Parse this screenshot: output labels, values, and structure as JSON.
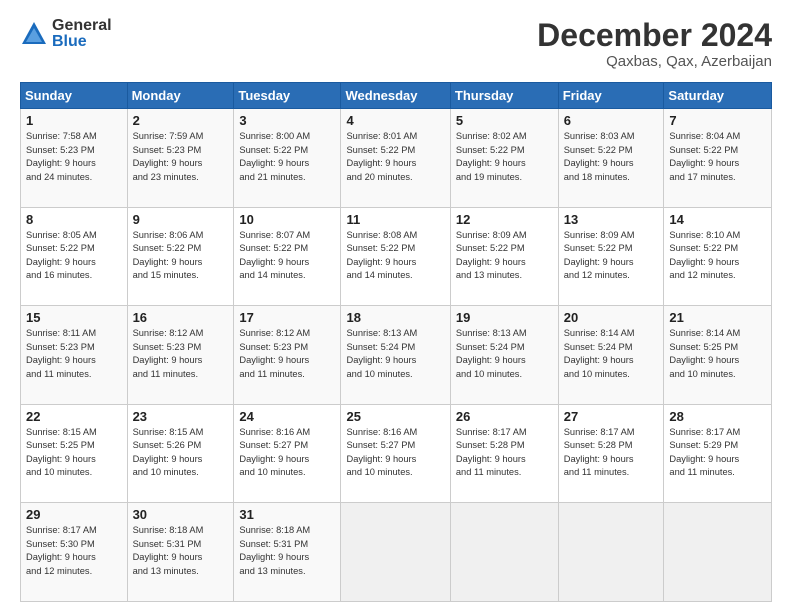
{
  "header": {
    "logo_general": "General",
    "logo_blue": "Blue",
    "month_title": "December 2024",
    "location": "Qaxbas, Qax, Azerbaijan"
  },
  "weekdays": [
    "Sunday",
    "Monday",
    "Tuesday",
    "Wednesday",
    "Thursday",
    "Friday",
    "Saturday"
  ],
  "weeks": [
    [
      {
        "day": "1",
        "lines": [
          "Sunrise: 7:58 AM",
          "Sunset: 5:23 PM",
          "Daylight: 9 hours",
          "and 24 minutes."
        ]
      },
      {
        "day": "2",
        "lines": [
          "Sunrise: 7:59 AM",
          "Sunset: 5:23 PM",
          "Daylight: 9 hours",
          "and 23 minutes."
        ]
      },
      {
        "day": "3",
        "lines": [
          "Sunrise: 8:00 AM",
          "Sunset: 5:22 PM",
          "Daylight: 9 hours",
          "and 21 minutes."
        ]
      },
      {
        "day": "4",
        "lines": [
          "Sunrise: 8:01 AM",
          "Sunset: 5:22 PM",
          "Daylight: 9 hours",
          "and 20 minutes."
        ]
      },
      {
        "day": "5",
        "lines": [
          "Sunrise: 8:02 AM",
          "Sunset: 5:22 PM",
          "Daylight: 9 hours",
          "and 19 minutes."
        ]
      },
      {
        "day": "6",
        "lines": [
          "Sunrise: 8:03 AM",
          "Sunset: 5:22 PM",
          "Daylight: 9 hours",
          "and 18 minutes."
        ]
      },
      {
        "day": "7",
        "lines": [
          "Sunrise: 8:04 AM",
          "Sunset: 5:22 PM",
          "Daylight: 9 hours",
          "and 17 minutes."
        ]
      }
    ],
    [
      {
        "day": "8",
        "lines": [
          "Sunrise: 8:05 AM",
          "Sunset: 5:22 PM",
          "Daylight: 9 hours",
          "and 16 minutes."
        ]
      },
      {
        "day": "9",
        "lines": [
          "Sunrise: 8:06 AM",
          "Sunset: 5:22 PM",
          "Daylight: 9 hours",
          "and 15 minutes."
        ]
      },
      {
        "day": "10",
        "lines": [
          "Sunrise: 8:07 AM",
          "Sunset: 5:22 PM",
          "Daylight: 9 hours",
          "and 14 minutes."
        ]
      },
      {
        "day": "11",
        "lines": [
          "Sunrise: 8:08 AM",
          "Sunset: 5:22 PM",
          "Daylight: 9 hours",
          "and 14 minutes."
        ]
      },
      {
        "day": "12",
        "lines": [
          "Sunrise: 8:09 AM",
          "Sunset: 5:22 PM",
          "Daylight: 9 hours",
          "and 13 minutes."
        ]
      },
      {
        "day": "13",
        "lines": [
          "Sunrise: 8:09 AM",
          "Sunset: 5:22 PM",
          "Daylight: 9 hours",
          "and 12 minutes."
        ]
      },
      {
        "day": "14",
        "lines": [
          "Sunrise: 8:10 AM",
          "Sunset: 5:22 PM",
          "Daylight: 9 hours",
          "and 12 minutes."
        ]
      }
    ],
    [
      {
        "day": "15",
        "lines": [
          "Sunrise: 8:11 AM",
          "Sunset: 5:23 PM",
          "Daylight: 9 hours",
          "and 11 minutes."
        ]
      },
      {
        "day": "16",
        "lines": [
          "Sunrise: 8:12 AM",
          "Sunset: 5:23 PM",
          "Daylight: 9 hours",
          "and 11 minutes."
        ]
      },
      {
        "day": "17",
        "lines": [
          "Sunrise: 8:12 AM",
          "Sunset: 5:23 PM",
          "Daylight: 9 hours",
          "and 11 minutes."
        ]
      },
      {
        "day": "18",
        "lines": [
          "Sunrise: 8:13 AM",
          "Sunset: 5:24 PM",
          "Daylight: 9 hours",
          "and 10 minutes."
        ]
      },
      {
        "day": "19",
        "lines": [
          "Sunrise: 8:13 AM",
          "Sunset: 5:24 PM",
          "Daylight: 9 hours",
          "and 10 minutes."
        ]
      },
      {
        "day": "20",
        "lines": [
          "Sunrise: 8:14 AM",
          "Sunset: 5:24 PM",
          "Daylight: 9 hours",
          "and 10 minutes."
        ]
      },
      {
        "day": "21",
        "lines": [
          "Sunrise: 8:14 AM",
          "Sunset: 5:25 PM",
          "Daylight: 9 hours",
          "and 10 minutes."
        ]
      }
    ],
    [
      {
        "day": "22",
        "lines": [
          "Sunrise: 8:15 AM",
          "Sunset: 5:25 PM",
          "Daylight: 9 hours",
          "and 10 minutes."
        ]
      },
      {
        "day": "23",
        "lines": [
          "Sunrise: 8:15 AM",
          "Sunset: 5:26 PM",
          "Daylight: 9 hours",
          "and 10 minutes."
        ]
      },
      {
        "day": "24",
        "lines": [
          "Sunrise: 8:16 AM",
          "Sunset: 5:27 PM",
          "Daylight: 9 hours",
          "and 10 minutes."
        ]
      },
      {
        "day": "25",
        "lines": [
          "Sunrise: 8:16 AM",
          "Sunset: 5:27 PM",
          "Daylight: 9 hours",
          "and 10 minutes."
        ]
      },
      {
        "day": "26",
        "lines": [
          "Sunrise: 8:17 AM",
          "Sunset: 5:28 PM",
          "Daylight: 9 hours",
          "and 11 minutes."
        ]
      },
      {
        "day": "27",
        "lines": [
          "Sunrise: 8:17 AM",
          "Sunset: 5:28 PM",
          "Daylight: 9 hours",
          "and 11 minutes."
        ]
      },
      {
        "day": "28",
        "lines": [
          "Sunrise: 8:17 AM",
          "Sunset: 5:29 PM",
          "Daylight: 9 hours",
          "and 11 minutes."
        ]
      }
    ],
    [
      {
        "day": "29",
        "lines": [
          "Sunrise: 8:17 AM",
          "Sunset: 5:30 PM",
          "Daylight: 9 hours",
          "and 12 minutes."
        ]
      },
      {
        "day": "30",
        "lines": [
          "Sunrise: 8:18 AM",
          "Sunset: 5:31 PM",
          "Daylight: 9 hours",
          "and 13 minutes."
        ]
      },
      {
        "day": "31",
        "lines": [
          "Sunrise: 8:18 AM",
          "Sunset: 5:31 PM",
          "Daylight: 9 hours",
          "and 13 minutes."
        ]
      },
      null,
      null,
      null,
      null
    ]
  ]
}
